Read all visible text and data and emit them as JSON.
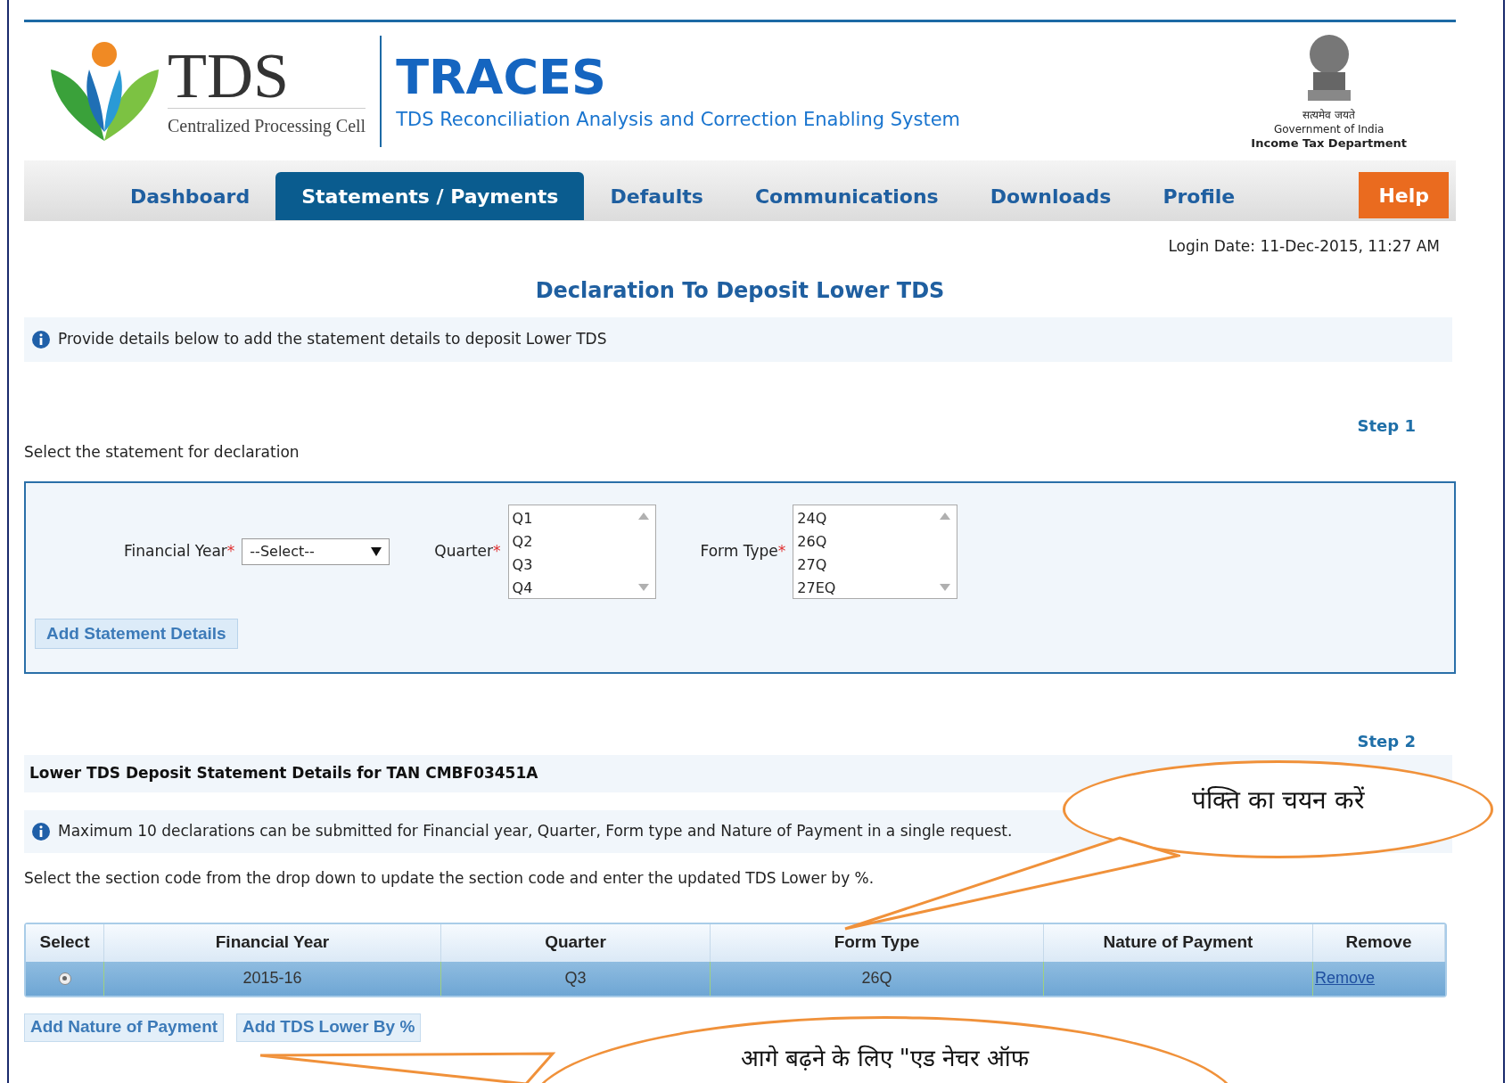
{
  "header": {
    "logo_text": "TDS",
    "logo_subtitle": "Centralized Processing Cell",
    "app_title": "TRACES",
    "app_subtitle": "TDS Reconciliation Analysis and Correction Enabling System",
    "emblem_lines": [
      "सत्यमेव जयते",
      "Government of India",
      "Income Tax Department"
    ]
  },
  "nav": {
    "items": [
      {
        "label": "Dashboard",
        "selected": false
      },
      {
        "label": "Statements / Payments",
        "selected": true
      },
      {
        "label": "Defaults",
        "selected": false
      },
      {
        "label": "Communications",
        "selected": false
      },
      {
        "label": "Downloads",
        "selected": false
      },
      {
        "label": "Profile",
        "selected": false
      }
    ],
    "help": "Help"
  },
  "login_date": "Login Date: 11-Dec-2015, 11:27 AM",
  "page_title": "Declaration To Deposit Lower TDS",
  "info": "Provide details below to add the statement details to deposit Lower TDS",
  "step1": {
    "step": "Step 1",
    "instruction": "Select the statement for declaration",
    "financial_year": {
      "label": "Financial Year",
      "required_mark": "*",
      "value": "--Select--"
    },
    "quarter": {
      "label": "Quarter",
      "required_mark": "*",
      "options": [
        "Q1",
        "Q2",
        "Q3",
        "Q4"
      ]
    },
    "form_type": {
      "label": "Form Type",
      "required_mark": "*",
      "options": [
        "24Q",
        "26Q",
        "27Q",
        "27EQ"
      ]
    },
    "button": "Add Statement Details"
  },
  "step2": {
    "step": "Step 2",
    "section_title": "Lower TDS Deposit Statement Details for TAN CMBF03451A",
    "info": "Maximum 10 declarations can be submitted for Financial year, Quarter, Form type and Nature of Payment in a single request.",
    "instruction": "Select the section code from the drop down to update the section code and enter the updated TDS Lower by %.",
    "table": {
      "columns": [
        "Select",
        "Financial Year",
        "Quarter",
        "Form Type",
        "Nature of Payment",
        "Remove"
      ],
      "rows": [
        {
          "selected": true,
          "checked": true,
          "financial_year": "2015-16",
          "quarter": "Q3",
          "form_type": "26Q",
          "remove": "Remove"
        }
      ]
    },
    "buttons": [
      "Add Nature of Payment",
      "Add TDS Lower By %"
    ]
  },
  "callouts": [
    {
      "text": "पंक्ति का चयन करें"
    },
    {
      "text": "आगे बढ़ने के लिए \"एड नेचर ऑफ"
    }
  ]
}
